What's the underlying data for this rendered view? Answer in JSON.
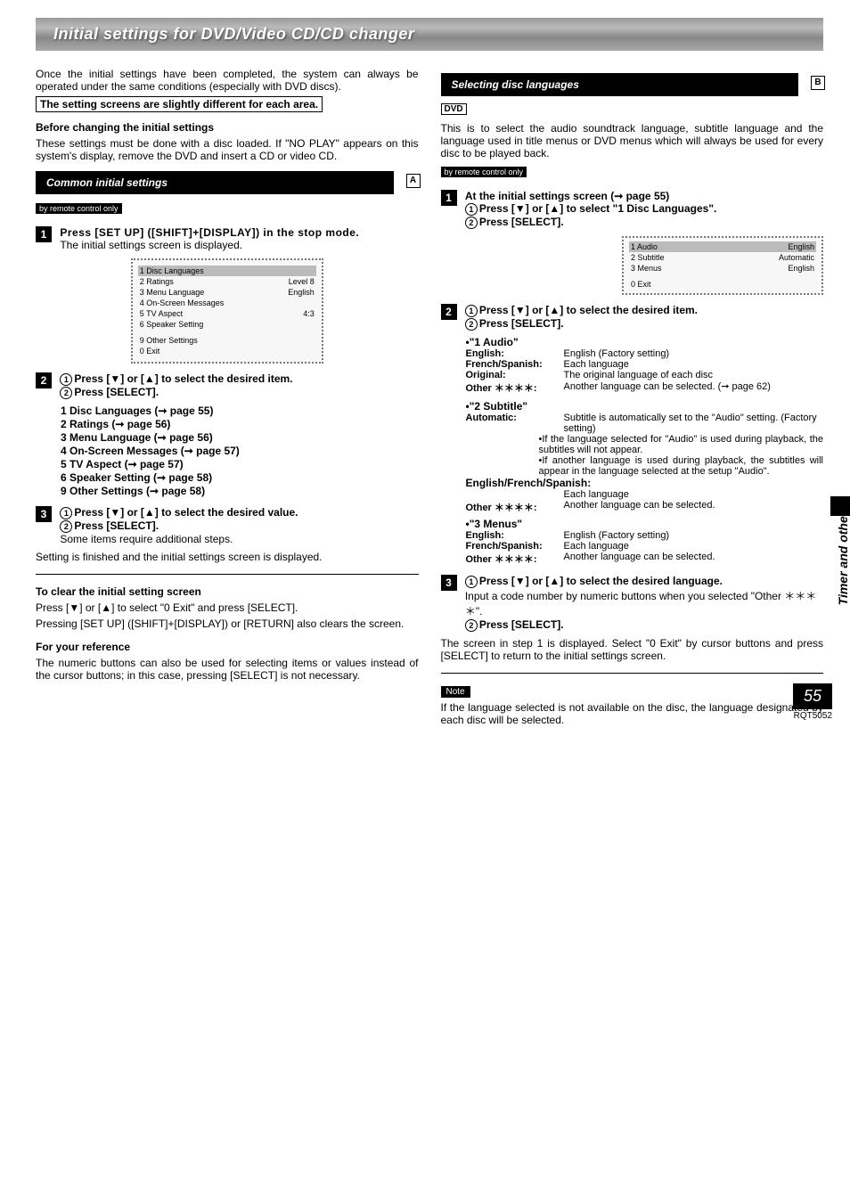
{
  "title": "Initial settings for DVD/Video CD/CD changer",
  "intro": "Once the initial settings have been completed, the system can always be operated under the same conditions (especially with DVD discs).",
  "note_box": "The setting screens are slightly different for each area.",
  "before_h": "Before changing the initial settings",
  "before_p": "These settings must be done with a disc loaded. If \"NO PLAY\" appears on this system's display, remove the DVD and insert a CD or video CD.",
  "sec_a": "Common initial settings",
  "remote": "by remote control only",
  "a_step1": "Press [SET UP] ([SHIFT]+[DISPLAY]) in the stop mode.",
  "a_step1_sub": "The initial settings screen is displayed.",
  "screen1": {
    "r1": {
      "l": "1 Disc Languages",
      "r": ""
    },
    "r2": {
      "l": "2 Ratings",
      "r": "Level 8"
    },
    "r3": {
      "l": "3 Menu Language",
      "r": "English"
    },
    "r4": {
      "l": "4 On-Screen Messages",
      "r": ""
    },
    "r5": {
      "l": "5 TV Aspect",
      "r": "4:3"
    },
    "r6": {
      "l": "6 Speaker Setting",
      "r": ""
    },
    "r9": {
      "l": "9 Other Settings",
      "r": ""
    },
    "r0": {
      "l": "0 Exit",
      "r": ""
    }
  },
  "a_step2_1": "Press [▼] or [▲] to select the desired item.",
  "a_step2_2": "Press [SELECT].",
  "a_list": [
    "1  Disc Languages (➞ page 55)",
    "2  Ratings (➞ page 56)",
    "3  Menu Language (➞ page 56)",
    "4  On-Screen Messages (➞ page 57)",
    "5  TV Aspect (➞ page 57)",
    "6  Speaker Setting (➞ page 58)",
    "9  Other Settings (➞ page 58)"
  ],
  "a_step3_1": "Press [▼] or [▲] to select the desired value.",
  "a_step3_2": "Press [SELECT].",
  "a_step3_sub": "Some items require additional steps.",
  "a_finish": "Setting is finished and the initial settings screen is displayed.",
  "clear_h": "To clear the initial setting screen",
  "clear_p1": "Press [▼] or [▲] to select \"0 Exit\" and press [SELECT].",
  "clear_p2": "Pressing [SET UP] ([SHIFT]+[DISPLAY]) or [RETURN] also clears the screen.",
  "ref_h": "For your reference",
  "ref_p": "The numeric buttons can also be used for selecting items or values instead of the cursor buttons; in this case, pressing [SELECT] is not necessary.",
  "sec_b": "Selecting disc languages",
  "dvd_tag": "DVD",
  "b_intro": "This is to select the audio soundtrack language, subtitle language and the language used in title menus or DVD menus which will always be used for every disc to be played back.",
  "b_step1_lead": "At the initial settings screen (➞ page 55)",
  "b_step1_1": "Press [▼] or [▲] to select \"1 Disc Languages\".",
  "b_step1_2": "Press [SELECT].",
  "screen2": {
    "r1": {
      "l": "1 Audio",
      "r": "English"
    },
    "r2": {
      "l": "2 Subtitle",
      "r": "Automatic"
    },
    "r3": {
      "l": "3 Menus",
      "r": "English"
    },
    "r0": {
      "l": "0 Exit",
      "r": ""
    }
  },
  "b_step2_1": "Press [▼] or [▲] to select the desired item.",
  "b_step2_2": "Press [SELECT].",
  "audio_h": "•\"1 Audio\"",
  "audio": {
    "english": {
      "k": "English:",
      "v": "English (Factory setting)"
    },
    "fs": {
      "k": "French/Spanish:",
      "v": "Each language"
    },
    "orig": {
      "k": "Original:",
      "v": "The original language of each disc"
    },
    "other": {
      "k": "Other ＊＊＊＊:",
      "v": "Another language can be selected. (➞ page 62)"
    }
  },
  "sub_h": "•\"2 Subtitle\"",
  "sub": {
    "auto": {
      "k": "Automatic:",
      "v": "Subtitle is automatically set to the \"Audio\" setting. (Factory setting)"
    },
    "b1": "•If the language selected for \"Audio\" is used during playback, the subtitles will not appear.",
    "b2": "•If another language is used during playback, the subtitles will appear in the language selected at the setup \"Audio\".",
    "efs_k": "English/French/Spanish:",
    "efs_v": "Each language",
    "other": {
      "k": "Other ＊＊＊＊:",
      "v": "Another language can be selected."
    }
  },
  "menus_h": "•\"3 Menus\"",
  "menus": {
    "english": {
      "k": "English:",
      "v": "English (Factory setting)"
    },
    "fs": {
      "k": "French/Spanish:",
      "v": "Each language"
    },
    "other": {
      "k": "Other ＊＊＊＊:",
      "v": "Another language can be selected."
    }
  },
  "b_step3_1": "Press [▼] or [▲] to select the desired language.",
  "b_step3_sub": "Input a code number by numeric buttons when you selected \"Other ＊＊＊＊\".",
  "b_step3_2": "Press [SELECT].",
  "b_end": "The screen in step 1 is displayed. Select \"0 Exit\" by cursor buttons and press [SELECT] to return to the initial settings screen.",
  "note_label": "Note",
  "note_p": "If the language selected is not available on the disc, the language designated by each disc will be selected.",
  "side": "Timer and others",
  "page_num": "55",
  "model": "RQT5052"
}
